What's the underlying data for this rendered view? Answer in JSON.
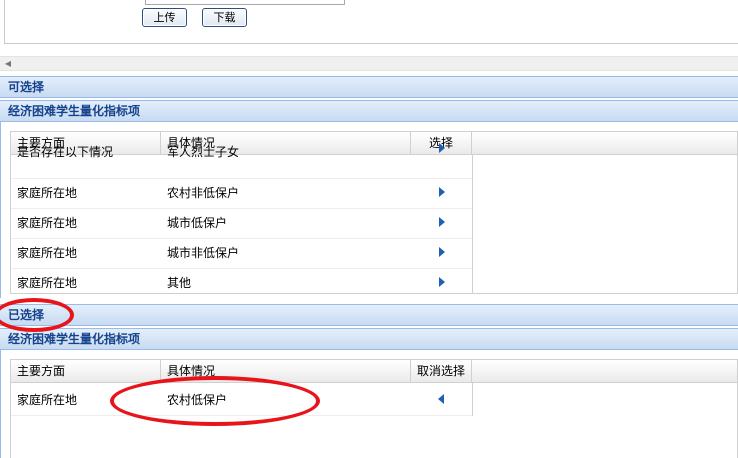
{
  "upload": {
    "upload_label": "上传",
    "download_label": "下载"
  },
  "available": {
    "section_title": "可选择",
    "subpanel_title": "经济困难学生量化指标项",
    "columns": [
      "主要方面",
      "具体情况",
      "选择"
    ],
    "rows": [
      {
        "aspect": "是否存在以下情况",
        "detail": "军人烈士子女"
      },
      {
        "aspect": "家庭所在地",
        "detail": "农村非低保户"
      },
      {
        "aspect": "家庭所在地",
        "detail": "城市低保户"
      },
      {
        "aspect": "家庭所在地",
        "detail": "城市非低保户"
      },
      {
        "aspect": "家庭所在地",
        "detail": "其他"
      }
    ]
  },
  "selected": {
    "section_title": "已选择",
    "subpanel_title": "经济困难学生量化指标项",
    "columns": [
      "主要方面",
      "具体情况",
      "取消选择"
    ],
    "rows": [
      {
        "aspect": "家庭所在地",
        "detail": "农村低保户"
      }
    ]
  },
  "colors": {
    "header_text": "#15428b",
    "annotation": "#e8141c",
    "arrow": "#1f5fb5"
  }
}
